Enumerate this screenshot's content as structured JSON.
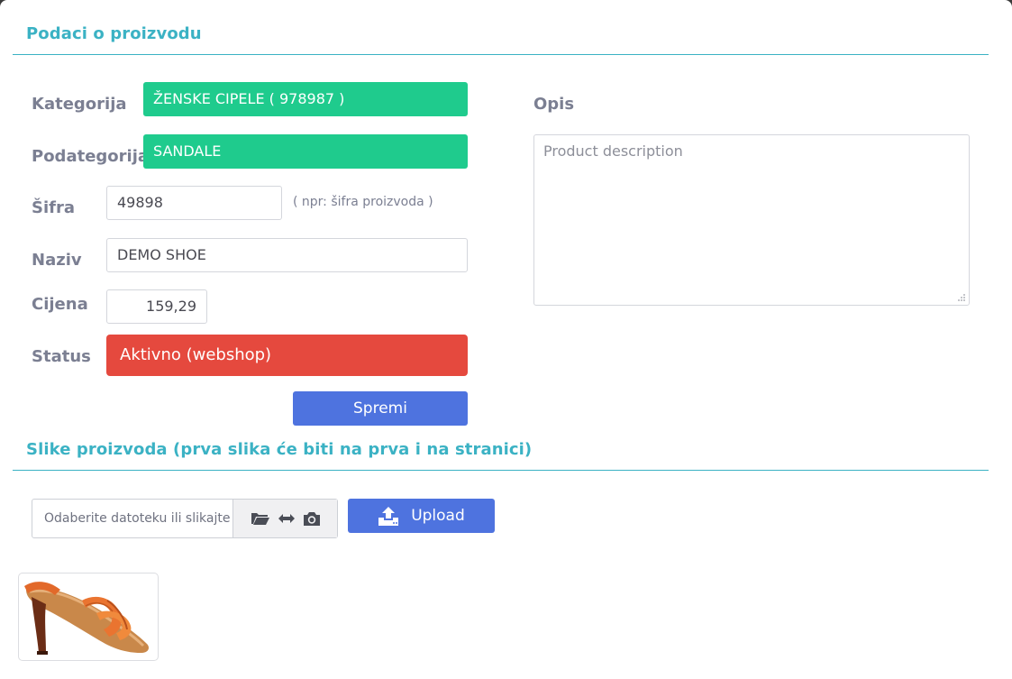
{
  "product_section": {
    "title": "Podaci o proizvodu",
    "fields": {
      "category": {
        "label": "Kategorija",
        "value": "ŽENSKE CIPELE ( 978987 )"
      },
      "subcategory": {
        "label": "Podategorija",
        "value": "SANDALE"
      },
      "code": {
        "label": "Šifra",
        "value": "49898",
        "hint": "( npr: šifra proizvoda )"
      },
      "name": {
        "label": "Naziv",
        "value": "DEMO SHOE"
      },
      "price": {
        "label": "Cijena",
        "value": "159,29"
      },
      "status": {
        "label": "Status",
        "value": "Aktivno (webshop)"
      }
    },
    "save_label": "Spremi",
    "description": {
      "label": "Opis",
      "placeholder": "Product description"
    }
  },
  "images_section": {
    "title": "Slike proizvoda (prva slika će biti na prva i na stranici)",
    "file_placeholder": "Odaberite datoteku ili slikajte",
    "upload_label": "Upload",
    "icons": [
      "folder-open-icon",
      "arrows-horizontal-icon",
      "camera-icon",
      "upload-icon"
    ]
  },
  "colors": {
    "accent": "#3bb2c4",
    "category_fill": "#1fcb8d",
    "status_fill": "#e5493e",
    "button_fill": "#4e73df"
  }
}
